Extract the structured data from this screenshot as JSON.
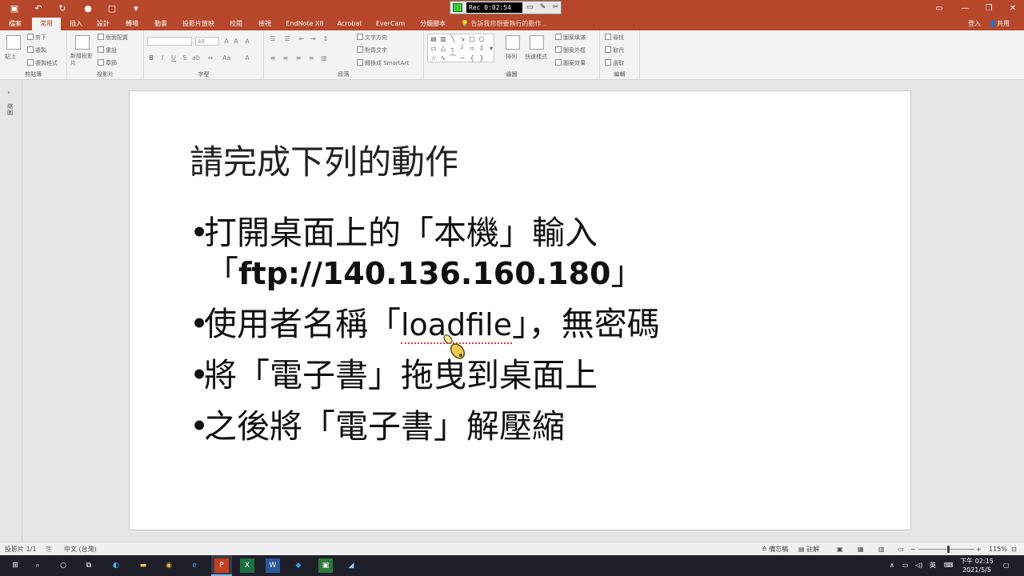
{
  "recorder": {
    "time": "Rec 0:02:54"
  },
  "tabs": [
    {
      "label": "檔案"
    },
    {
      "label": "常用"
    },
    {
      "label": "插入"
    },
    {
      "label": "設計"
    },
    {
      "label": "轉場"
    },
    {
      "label": "動畫"
    },
    {
      "label": "投影片放映"
    },
    {
      "label": "校閱"
    },
    {
      "label": "檢視"
    },
    {
      "label": "EndNote X8"
    },
    {
      "label": "Acrobat"
    },
    {
      "label": "EverCam"
    },
    {
      "label": "分鏡腳本"
    }
  ],
  "tell_me": "告訴我您想要執行的動作...",
  "sign_in": "登入",
  "share": "共用",
  "ribbon": {
    "clipboard": {
      "label": "剪貼簿",
      "paste": "貼上",
      "cut": "剪下",
      "copy": "複製",
      "format_painter": "複製格式"
    },
    "slides": {
      "label": "投影片",
      "new_slide": "新增投影片",
      "layout": "版面配置",
      "reset": "重設",
      "section": "章節"
    },
    "font": {
      "label": "字型",
      "size": "48"
    },
    "paragraph": {
      "label": "段落",
      "text_direction": "文字方向",
      "align_text": "對齊文字",
      "smartart": "轉換成 SmartArt"
    },
    "drawing": {
      "label": "繪圖",
      "arrange": "排列",
      "quick_styles": "快速樣式",
      "shape_fill": "圖案填滿",
      "shape_outline": "圖案外框",
      "shape_effects": "圖案效果"
    },
    "editing": {
      "label": "編輯",
      "find": "尋找",
      "replace": "取代",
      "select": "選取"
    }
  },
  "left_panel": {
    "label": "縮圖"
  },
  "slide": {
    "title": "請完成下列的動作",
    "bullet1_a": "打開桌面上的「本機」輸入",
    "bullet1_b_open": "「",
    "bullet1_b_ftp": "ftp://140.136.160.180",
    "bullet1_b_close": "」",
    "bullet2_pre": "使用者名稱「",
    "bullet2_user": "loadfile",
    "bullet2_post": "」，無密碼",
    "bullet3": "將「電子書」拖曳到桌面上",
    "bullet4": "之後將「電子書」解壓縮"
  },
  "status": {
    "slide_count": "投影片 1/1",
    "language": "中文 (台灣)",
    "notes": "備忘稿",
    "comments": "註解",
    "zoom": "115%"
  },
  "taskbar": {
    "ime": "英",
    "time": "下午 02:15",
    "date": "2021/5/5"
  }
}
